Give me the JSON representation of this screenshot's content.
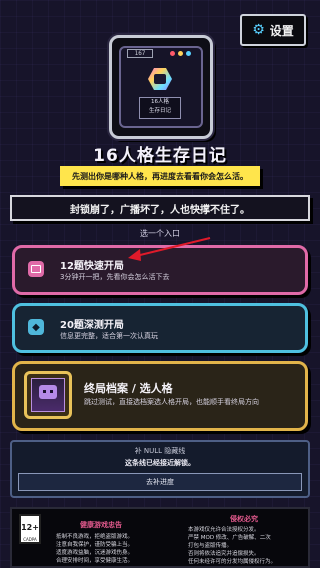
{
  "header": {
    "settings_label": "设置",
    "settings_icon": "gear-icon"
  },
  "logo": {
    "stat": "167",
    "tag_line1": "16人格",
    "tag_line2": "生存日记"
  },
  "title": "16人格生存日记",
  "banner": "先测出你是哪种人格，再进度去看看你会怎么活。",
  "notice": "封锁崩了，广播坏了，人也快撑不住了。",
  "choose_label": "选一个入口",
  "modes": {
    "quick": {
      "title": "12题快速开局",
      "subtitle": "3分钟开一把，先看你会怎么活下去",
      "icon": "screen-icon",
      "accent": "#e06aa8"
    },
    "deep": {
      "title": "20题深测开局",
      "subtitle": "信息更完整，适合第一次认真玩",
      "icon": "diamond-icon",
      "accent": "#4fc0e0"
    },
    "final": {
      "title": "终局档案 / 选人格",
      "subtitle": "跳过测试，直接选档案选人格开局，也能顺手看终局方向",
      "accent": "#e2b44a"
    }
  },
  "null_box": {
    "title": "补 NULL 隐藏线",
    "subtitle": "这条线已经接近解锁。",
    "button": "去补进度"
  },
  "footer": {
    "age_rating": "12+",
    "age_sub": "CADPA",
    "health_title": "健康游戏忠告",
    "health_lines": [
      "抵制不良游戏，拒绝盗版游戏。",
      "注意自我保护，谨防受骗上当。",
      "适度游戏益脑，沉迷游戏伤身。",
      "合理安排时间，享受健康生活。"
    ],
    "rights_title": "侵权必究",
    "rights_lines": [
      "本游戏仅允许合法授权分发。",
      "严禁 MOD 修改、广告破解、二次",
      "打包与盗版传播。",
      "否则将依法追究并追偿损失。",
      "任何未经许可的分发均属侵权行为。"
    ]
  }
}
